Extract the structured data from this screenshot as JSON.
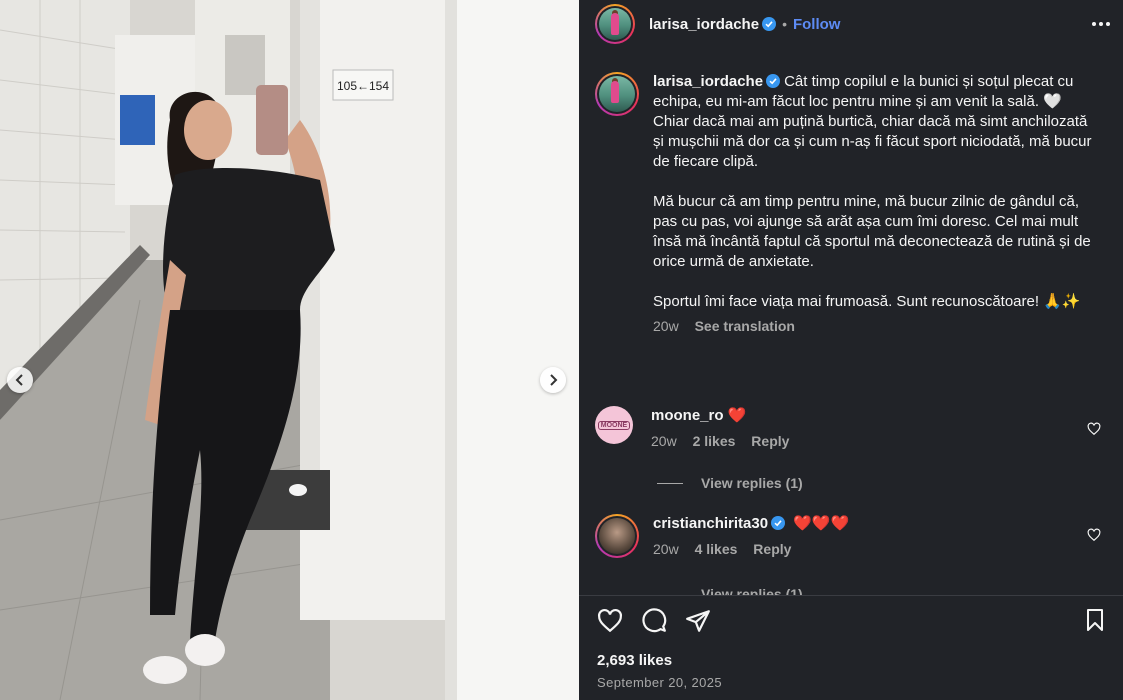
{
  "post": {
    "author": {
      "username": "larisa_iordache",
      "verified": true,
      "follow_label": "Follow"
    },
    "media": {
      "sign_text": "105←154",
      "carousel_prev": "chevron-left-icon",
      "carousel_next": "chevron-right-icon"
    },
    "caption": {
      "username": "larisa_iordache",
      "text": "Cât timp copilul e la bunici și soțul plecat cu echipa, eu mi-am făcut loc pentru mine și am venit la sală. 🤍\nChiar dacă mai am puțină burtică, chiar dacă mă simt anchilozată și mușchii mă dor ca și cum n-aș fi făcut sport niciodată, mă bucur de fiecare clipă.\n\nMă bucur că am timp pentru mine, mă bucur zilnic de gândul că, pas cu pas, voi ajunge să arăt așa cum îmi doresc. Cel mai mult însă mă încântă faptul că sportul mă deconectează de rutină și de orice urmă de anxietate.\n\nSportul îmi face viața mai frumoasă. Sunt recunoscătoare! 🙏✨",
      "age": "20w",
      "see_translation": "See translation"
    },
    "comments": [
      {
        "username": "moone_ro",
        "verified": false,
        "text": "❤️",
        "age": "20w",
        "likes": "2 likes",
        "reply": "Reply",
        "view_replies": "View replies (1)",
        "avatar_text": "MOONE"
      },
      {
        "username": "cristianchirita30",
        "verified": true,
        "text": "❤️❤️❤️",
        "age": "20w",
        "likes": "4 likes",
        "reply": "Reply",
        "view_replies": "View replies (1)"
      }
    ],
    "likes_count": "2,693 likes",
    "date": "September 20, 2025"
  },
  "colors": {
    "panel_bg": "#212328",
    "accent_link": "#5d8bf4",
    "verified_blue": "#3897f0",
    "muted_text": "#a8a8a8"
  }
}
